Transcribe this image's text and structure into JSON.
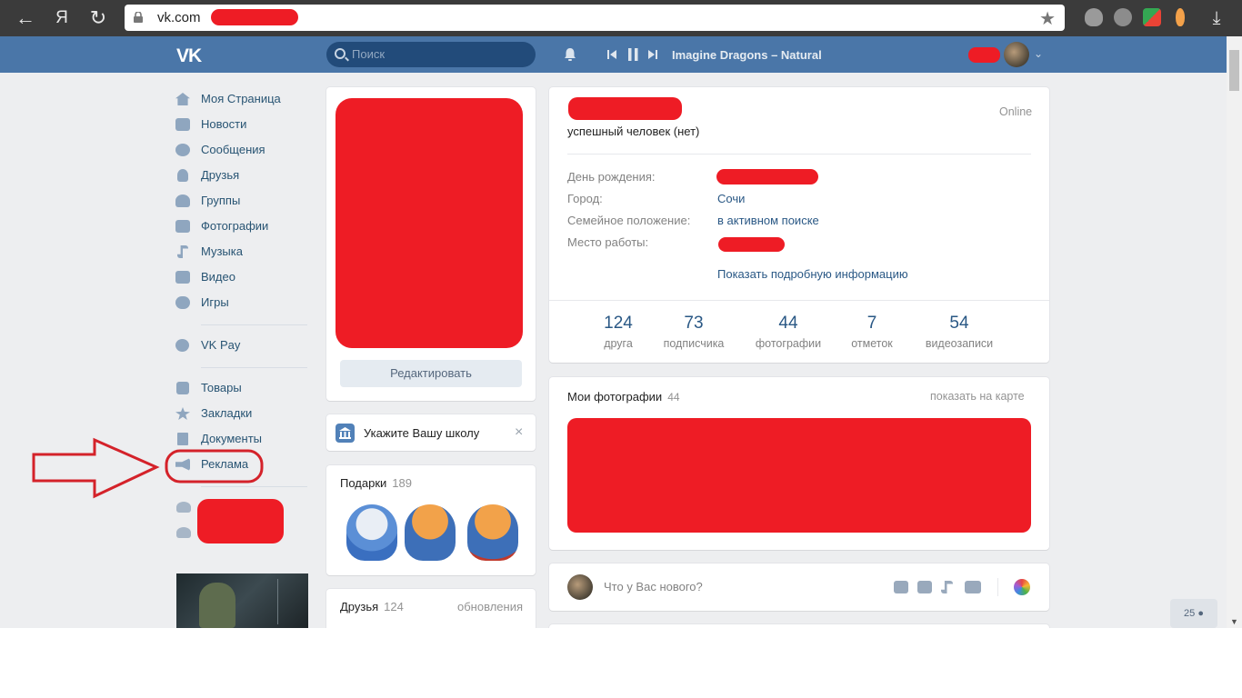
{
  "browser": {
    "url": "vk.com",
    "back_glyph": "←",
    "yandex_glyph": "Я",
    "reload_glyph": "↻",
    "star_glyph": "★",
    "download_glyph": "⤓"
  },
  "header": {
    "logo": "VK",
    "search_placeholder": "Поиск",
    "now_playing": "Imagine Dragons – Natural",
    "chevron": "⌄"
  },
  "sidebar": {
    "items": [
      {
        "label": "Моя Страница",
        "icon": "home-icon"
      },
      {
        "label": "Новости",
        "icon": "news-icon"
      },
      {
        "label": "Сообщения",
        "icon": "messages-icon"
      },
      {
        "label": "Друзья",
        "icon": "friends-icon"
      },
      {
        "label": "Группы",
        "icon": "groups-icon"
      },
      {
        "label": "Фотографии",
        "icon": "camera-icon"
      },
      {
        "label": "Музыка",
        "icon": "music-icon"
      },
      {
        "label": "Видео",
        "icon": "video-icon"
      },
      {
        "label": "Игры",
        "icon": "gamepad-icon"
      },
      {
        "label": "VK Pay",
        "icon": "vkpay-icon"
      },
      {
        "label": "Товары",
        "icon": "bag-icon"
      },
      {
        "label": "Закладки",
        "icon": "star-icon"
      },
      {
        "label": "Документы",
        "icon": "document-icon"
      },
      {
        "label": "Реклама",
        "icon": "megaphone-icon"
      }
    ]
  },
  "profile_left": {
    "edit_button": "Редактировать",
    "school_prompt": "Укажите Вашу школу",
    "close_glyph": "×",
    "gifts_title": "Подарки",
    "gifts_count": "189",
    "friends_title": "Друзья",
    "friends_count": "124",
    "friends_updates": "обновления"
  },
  "profile_info": {
    "status_online": "Online",
    "status_text": "успешный человек (нет)",
    "fields": [
      {
        "label": "День рождения:",
        "value": ""
      },
      {
        "label": "Город:",
        "value": "Сочи"
      },
      {
        "label": "Семейное положение:",
        "value": "в активном поиске"
      },
      {
        "label": "Место работы:",
        "value": ""
      }
    ],
    "show_more": "Показать подробную информацию"
  },
  "stats": [
    {
      "number": "124",
      "label": "друга"
    },
    {
      "number": "73",
      "label": "подписчика"
    },
    {
      "number": "44",
      "label": "фотографии"
    },
    {
      "number": "7",
      "label": "отметок"
    },
    {
      "number": "54",
      "label": "видеозаписи"
    }
  ],
  "photos": {
    "title": "Мои фотографии",
    "count": "44",
    "map_link": "показать на карте"
  },
  "post_box": {
    "placeholder": "Что у Вас нового?"
  },
  "online_counter": "25",
  "colors": {
    "vk_blue": "#4a76a8",
    "link": "#2a5885",
    "redaction": "#ee1c25",
    "page_bg": "#edeef0"
  }
}
